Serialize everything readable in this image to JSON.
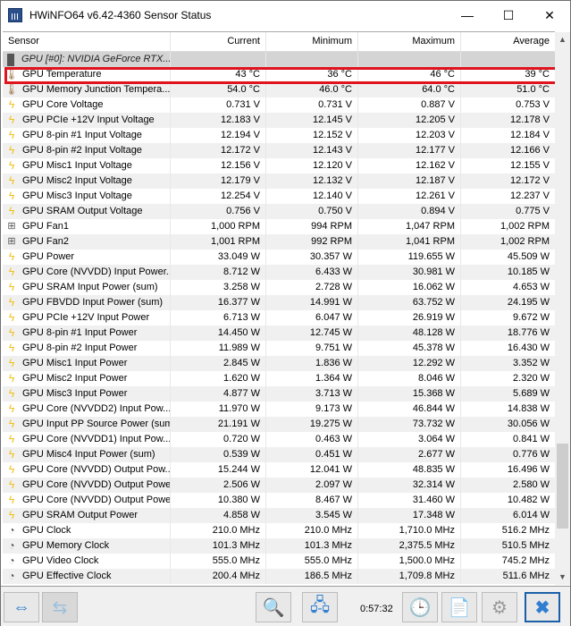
{
  "window": {
    "title": "HWiNFO64 v6.42-4360 Sensor Status",
    "minimize": "—",
    "maximize": "☐",
    "close": "✕"
  },
  "columns": [
    "Sensor",
    "Current",
    "Minimum",
    "Maximum",
    "Average"
  ],
  "group": "GPU [#0]: NVIDIA GeForce RTX...",
  "rows": [
    {
      "icon": "thermometer",
      "name": "GPU Temperature",
      "cur": "43 °C",
      "min": "36 °C",
      "max": "46 °C",
      "avg": "39 °C",
      "highlighted": true
    },
    {
      "icon": "thermometer",
      "name": "GPU Memory Junction Tempera...",
      "cur": "54.0 °C",
      "min": "46.0 °C",
      "max": "64.0 °C",
      "avg": "51.0 °C"
    },
    {
      "icon": "bolt",
      "name": "GPU Core Voltage",
      "cur": "0.731 V",
      "min": "0.731 V",
      "max": "0.887 V",
      "avg": "0.753 V"
    },
    {
      "icon": "bolt",
      "name": "GPU PCIe +12V Input Voltage",
      "cur": "12.183 V",
      "min": "12.145 V",
      "max": "12.205 V",
      "avg": "12.178 V"
    },
    {
      "icon": "bolt",
      "name": "GPU 8-pin #1 Input Voltage",
      "cur": "12.194 V",
      "min": "12.152 V",
      "max": "12.203 V",
      "avg": "12.184 V"
    },
    {
      "icon": "bolt",
      "name": "GPU 8-pin #2 Input Voltage",
      "cur": "12.172 V",
      "min": "12.143 V",
      "max": "12.177 V",
      "avg": "12.166 V"
    },
    {
      "icon": "bolt",
      "name": "GPU Misc1 Input Voltage",
      "cur": "12.156 V",
      "min": "12.120 V",
      "max": "12.162 V",
      "avg": "12.155 V"
    },
    {
      "icon": "bolt",
      "name": "GPU Misc2 Input Voltage",
      "cur": "12.179 V",
      "min": "12.132 V",
      "max": "12.187 V",
      "avg": "12.172 V"
    },
    {
      "icon": "bolt",
      "name": "GPU Misc3 Input Voltage",
      "cur": "12.254 V",
      "min": "12.140 V",
      "max": "12.261 V",
      "avg": "12.237 V"
    },
    {
      "icon": "bolt",
      "name": "GPU SRAM Output Voltage",
      "cur": "0.756 V",
      "min": "0.750 V",
      "max": "0.894 V",
      "avg": "0.775 V"
    },
    {
      "icon": "fan",
      "name": "GPU Fan1",
      "cur": "1,000 RPM",
      "min": "994 RPM",
      "max": "1,047 RPM",
      "avg": "1,002 RPM"
    },
    {
      "icon": "fan",
      "name": "GPU Fan2",
      "cur": "1,001 RPM",
      "min": "992 RPM",
      "max": "1,041 RPM",
      "avg": "1,002 RPM"
    },
    {
      "icon": "bolt",
      "name": "GPU Power",
      "cur": "33.049 W",
      "min": "30.357 W",
      "max": "119.655 W",
      "avg": "45.509 W"
    },
    {
      "icon": "bolt",
      "name": "GPU Core (NVVDD) Input Power...",
      "cur": "8.712 W",
      "min": "6.433 W",
      "max": "30.981 W",
      "avg": "10.185 W"
    },
    {
      "icon": "bolt",
      "name": "GPU SRAM Input Power (sum)",
      "cur": "3.258 W",
      "min": "2.728 W",
      "max": "16.062 W",
      "avg": "4.653 W"
    },
    {
      "icon": "bolt",
      "name": "GPU FBVDD Input Power (sum)",
      "cur": "16.377 W",
      "min": "14.991 W",
      "max": "63.752 W",
      "avg": "24.195 W"
    },
    {
      "icon": "bolt",
      "name": "GPU PCIe +12V Input Power",
      "cur": "6.713 W",
      "min": "6.047 W",
      "max": "26.919 W",
      "avg": "9.672 W"
    },
    {
      "icon": "bolt",
      "name": "GPU 8-pin #1 Input Power",
      "cur": "14.450 W",
      "min": "12.745 W",
      "max": "48.128 W",
      "avg": "18.776 W"
    },
    {
      "icon": "bolt",
      "name": "GPU 8-pin #2 Input Power",
      "cur": "11.989 W",
      "min": "9.751 W",
      "max": "45.378 W",
      "avg": "16.430 W"
    },
    {
      "icon": "bolt",
      "name": "GPU Misc1 Input Power",
      "cur": "2.845 W",
      "min": "1.836 W",
      "max": "12.292 W",
      "avg": "3.352 W"
    },
    {
      "icon": "bolt",
      "name": "GPU Misc2 Input Power",
      "cur": "1.620 W",
      "min": "1.364 W",
      "max": "8.046 W",
      "avg": "2.320 W"
    },
    {
      "icon": "bolt",
      "name": "GPU Misc3 Input Power",
      "cur": "4.877 W",
      "min": "3.713 W",
      "max": "15.368 W",
      "avg": "5.689 W"
    },
    {
      "icon": "bolt",
      "name": "GPU Core (NVVDD2) Input Pow...",
      "cur": "11.970 W",
      "min": "9.173 W",
      "max": "46.844 W",
      "avg": "14.838 W"
    },
    {
      "icon": "bolt",
      "name": "GPU Input PP Source Power (sum)",
      "cur": "21.191 W",
      "min": "19.275 W",
      "max": "73.732 W",
      "avg": "30.056 W"
    },
    {
      "icon": "bolt",
      "name": "GPU Core (NVVDD1) Input Pow...",
      "cur": "0.720 W",
      "min": "0.463 W",
      "max": "3.064 W",
      "avg": "0.841 W"
    },
    {
      "icon": "bolt",
      "name": "GPU Misc4 Input Power (sum)",
      "cur": "0.539 W",
      "min": "0.451 W",
      "max": "2.677 W",
      "avg": "0.776 W"
    },
    {
      "icon": "bolt",
      "name": "GPU Core (NVVDD) Output Pow...",
      "cur": "15.244 W",
      "min": "12.041 W",
      "max": "48.835 W",
      "avg": "16.496 W"
    },
    {
      "icon": "bolt",
      "name": "GPU Core (NVVDD) Output Power",
      "cur": "2.506 W",
      "min": "2.097 W",
      "max": "32.314 W",
      "avg": "2.580 W"
    },
    {
      "icon": "bolt",
      "name": "GPU Core (NVVDD) Output Power",
      "cur": "10.380 W",
      "min": "8.467 W",
      "max": "31.460 W",
      "avg": "10.482 W"
    },
    {
      "icon": "bolt",
      "name": "GPU SRAM Output Power",
      "cur": "4.858 W",
      "min": "3.545 W",
      "max": "17.348 W",
      "avg": "6.014 W"
    },
    {
      "icon": "clock",
      "name": "GPU Clock",
      "cur": "210.0 MHz",
      "min": "210.0 MHz",
      "max": "1,710.0 MHz",
      "avg": "516.2 MHz"
    },
    {
      "icon": "clock",
      "name": "GPU Memory Clock",
      "cur": "101.3 MHz",
      "min": "101.3 MHz",
      "max": "2,375.5 MHz",
      "avg": "510.5 MHz"
    },
    {
      "icon": "clock",
      "name": "GPU Video Clock",
      "cur": "555.0 MHz",
      "min": "555.0 MHz",
      "max": "1,500.0 MHz",
      "avg": "745.2 MHz"
    },
    {
      "icon": "clock",
      "name": "GPU Effective Clock",
      "cur": "200.4 MHz",
      "min": "186.5 MHz",
      "max": "1,709.8 MHz",
      "avg": "511.6 MHz"
    }
  ],
  "toolbar": {
    "elapsed": "0:57:32"
  },
  "colors": {
    "highlight": "#e0141e",
    "bolt": "#f2c014",
    "accent": "#2f7fd0"
  }
}
